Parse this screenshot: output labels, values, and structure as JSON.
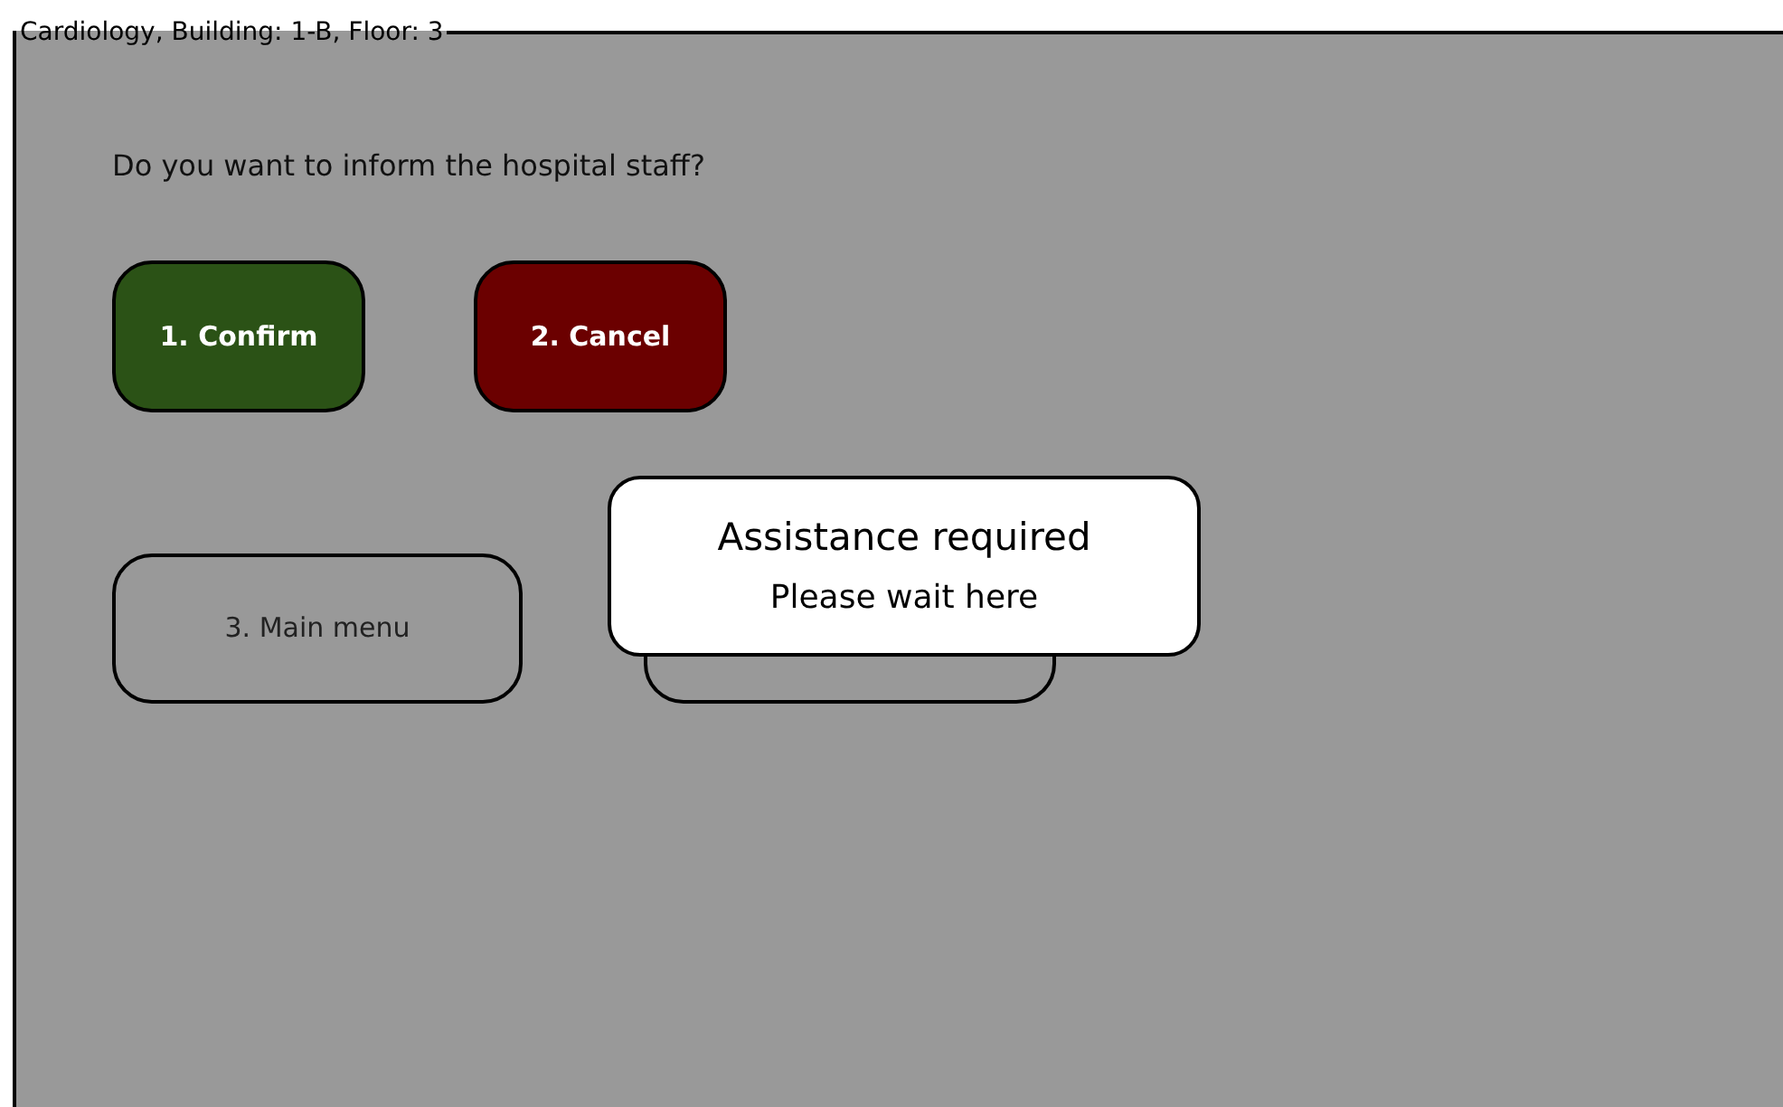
{
  "panel": {
    "title": "Cardiology, Building: 1-B, Floor: 3"
  },
  "question": "Do you want to inform the hospital staff?",
  "actions": [
    {
      "label": "1. Confirm",
      "kind": "confirm"
    },
    {
      "label": "2. Cancel",
      "kind": "cancel"
    }
  ],
  "secondary_actions": [
    {
      "label": "3. Main menu"
    }
  ],
  "popup": {
    "title": "Assistance required",
    "message": "Please wait here"
  }
}
